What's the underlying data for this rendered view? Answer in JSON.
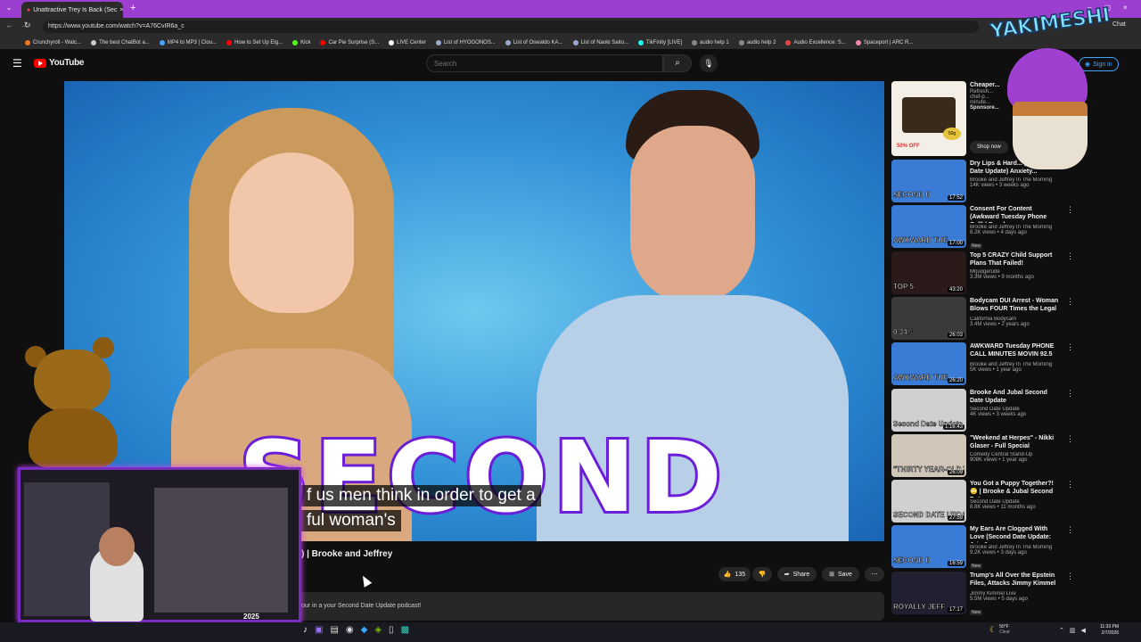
{
  "browser": {
    "tab_title": "Unattractive Trey Is Back (Sec",
    "url": "https://www.youtube.com/watch?v=A76CvIR6a_c",
    "profile_label": "Chat",
    "bookmarks": [
      "Crunchyroll - Watc...",
      "The best ChatBot a...",
      "MP4 to MP3 | Clou...",
      "How to Set Up Elg...",
      "Kick",
      "Car Pie Surprise (S...",
      "LIVE Center",
      "List of HYOGONOS...",
      "List of Oswaldo KA...",
      "List of Naoki Saito...",
      "TikFinity [LIVE]",
      "audio help 1",
      "audio help 2",
      "Audio Excellence: S...",
      "Spaceport | ARC R..."
    ]
  },
  "youtube": {
    "logo_text": "YouTube",
    "search_placeholder": "Search",
    "signin_label": "Sign in"
  },
  "video": {
    "thumbnail_text": "SECOND DATE",
    "caption_line1": "f us men think in order to get a",
    "caption_line2": "ful woman's",
    "title_partial": ") | Brooke and Jeffrey",
    "like_count": "135",
    "share_label": "Share",
    "save_label": "Save",
    "description_partial": "our in a your Second Date Update podcast!"
  },
  "ad": {
    "title": "Cheaper...",
    "line1": "Refresh...",
    "line2": "chef-p...",
    "line3": "minute...",
    "sponsor": "Sponsore...",
    "cta": "Shop now",
    "thumb_badge": "50% OFF",
    "thumb_badge2": "50g"
  },
  "sidebar": [
    {
      "title": "Dry Lips & Hard... (Second Date Update) Anxiety...",
      "channel": "Brooke and Jeffrey In The Morning",
      "meta": "14K views • 3 weeks ago",
      "duration": "17:52",
      "thumb_text": "SECOND D",
      "badge": ""
    },
    {
      "title": "Consent For Content (Awkward Tuesday Phone Call) | Brooke ...",
      "channel": "Brooke and Jeffrey In The Morning",
      "meta": "8.2K views • 4 days ago",
      "duration": "17:00",
      "thumb_text": "AWKWARD TUE",
      "badge": "New"
    },
    {
      "title": "Top 5 CRAZY Child Support Plans That Failed!",
      "channel": "Mrjudgerude",
      "meta": "3.3M views • 9 months ago",
      "duration": "43:20",
      "thumb_text": "TOP 5",
      "badge": ""
    },
    {
      "title": "Bodycam DUI Arrest - Woman Blows FOUR Times the Legal ...",
      "channel": "California Bodycam",
      "meta": "3.4M views • 2 years ago",
      "duration": "26:03",
      "thumb_text": "0.34%",
      "badge": ""
    },
    {
      "title": "AWKWARD Tuesday PHONE CALL MINUTES MOVIN 92.5 o...",
      "channel": "Brooke and Jeffrey In The Morning",
      "meta": "5K views • 1 year ago",
      "duration": "26:20",
      "thumb_text": "AWKWARD TUE",
      "badge": ""
    },
    {
      "title": "Brooke And Jubal Second Date Update",
      "channel": "Second Date Update",
      "meta": "4K views • 3 weeks ago",
      "duration": "1:16:43",
      "thumb_text": "Second Date Update",
      "badge": ""
    },
    {
      "title": "\"Weekend at Herpes\" - Nikki Glaser - Full Special",
      "channel": "Comedy Central Stand-Up",
      "meta": "908K views • 1 year ago",
      "duration": "26:09",
      "thumb_text": "\"THIRTY YEAR-OLD WITH A TWIN BED\"",
      "badge": ""
    },
    {
      "title": "You Got a Puppy Together?! 🙄 | Brooke & Jubal Second Date ...",
      "channel": "Second Date Update",
      "meta": "8.8K views • 11 months ago",
      "duration": "27:59",
      "thumb_text": "SECOND DATE UPDATE",
      "badge": ""
    },
    {
      "title": "My Ears Are Clogged With Love (Second Date Update: Aria & ...",
      "channel": "Brooke and Jeffrey In The Morning",
      "meta": "9.2K views • 3 days ago",
      "duration": "16:59",
      "thumb_text": "SECOND D",
      "badge": "New"
    },
    {
      "title": "Trump's All Over the Epstein Files, Attacks Jimmy Kimmel ...",
      "channel": "Jimmy Kimmel Live",
      "meta": "5.5M views • 5 days ago",
      "duration": "17:17",
      "thumb_text": "ROYALLY JEFF",
      "badge": "New"
    }
  ],
  "overlay": {
    "logo_text": "YAKIMESHI",
    "cam_year": "2025"
  },
  "taskbar": {
    "weather": "50°F",
    "weather_sub": "Clear",
    "time": "11:33 PM",
    "date": "2/7/2026"
  },
  "colors": {
    "tab_bar": "#9c3fd0",
    "accent_red": "#ff0000",
    "headline_stroke": "#6a1ed8",
    "cam_border": "#7b2cc0"
  }
}
